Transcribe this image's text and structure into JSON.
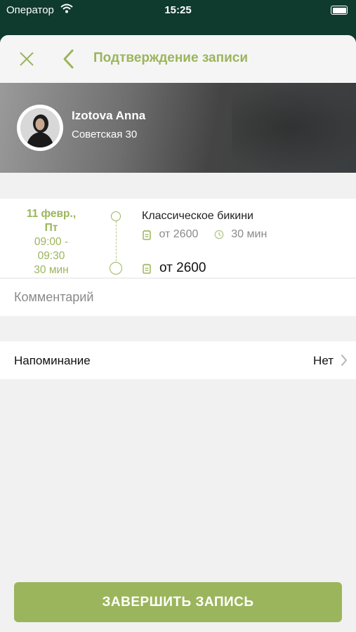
{
  "status_bar": {
    "carrier": "Оператор",
    "time": "15:25"
  },
  "nav": {
    "title": "Подтверждение записи"
  },
  "specialist": {
    "name": "Izotova Anna",
    "address": "Советская 30"
  },
  "appointment": {
    "date": "11 февр.,",
    "day": "Пт",
    "time_start": "09:00 -",
    "time_end": "09:30",
    "duration": "30 мин"
  },
  "service": {
    "name": "Классическое бикини",
    "price": "от 2600",
    "duration": "30 мин"
  },
  "total": {
    "price": "от 2600"
  },
  "comment": {
    "placeholder": "Комментарий",
    "value": ""
  },
  "reminder": {
    "label": "Напоминание",
    "value": "Нет"
  },
  "submit_button": {
    "label": "ЗАВЕРШИТЬ ЗАПИСЬ"
  },
  "colors": {
    "accent": "#9bb55c",
    "background": "#f1f1f1",
    "status_bar_bg": "#0f3a2e"
  },
  "icons": [
    "wifi-icon",
    "battery-icon",
    "close-icon",
    "chevron-left-icon",
    "price-tag-icon",
    "clock-icon",
    "chevron-right-icon"
  ]
}
